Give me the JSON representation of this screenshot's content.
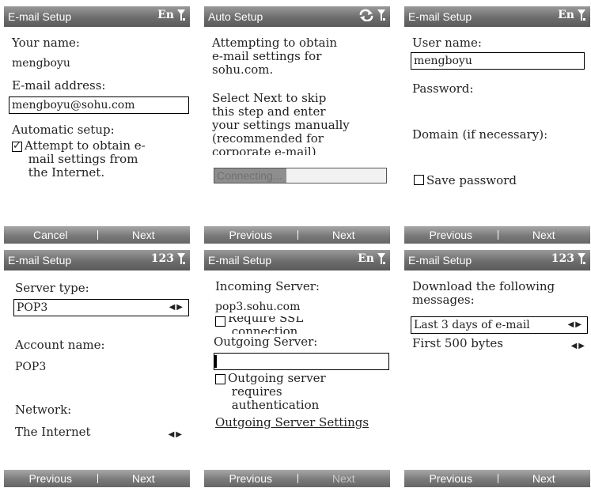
{
  "screens": [
    {
      "title": "E-mail Setup",
      "indicator": "En",
      "name_label": "Your name:",
      "name_value": "mengboyu",
      "email_label": "E-mail address:",
      "email_value": "mengboyu@sohu.com",
      "auto_label": "Automatic setup:",
      "auto_checkbox": "Attempt to obtain e-\n mail settings from\n the Internet.",
      "left_soft": "Cancel",
      "right_soft": "Next"
    },
    {
      "title": "Auto Setup",
      "indicator": "",
      "message1": "Attempting to obtain\ne-mail settings for\nsohu.com.",
      "message2": "Select Next to skip\nthis step and enter\nyour settings manually\n(recommended for\ncorporate e-mail)",
      "progress_text": "Connecting...",
      "progress_fraction": 0.42,
      "left_soft": "Previous",
      "right_soft": "Next"
    },
    {
      "title": "E-mail Setup",
      "indicator": "En",
      "user_label": "User name:",
      "user_value": "mengboyu",
      "password_label": "Password:",
      "domain_label": "Domain (if necessary):",
      "save_password": "Save password",
      "left_soft": "Previous",
      "right_soft": "Next"
    },
    {
      "title": "E-mail Setup",
      "indicator": "123",
      "server_type_label": "Server type:",
      "server_type_value": "POP3",
      "account_label": "Account name:",
      "account_value": "POP3",
      "network_label": "Network:",
      "network_value": "The Internet",
      "left_soft": "Previous",
      "right_soft": "Next"
    },
    {
      "title": "E-mail Setup",
      "indicator": "En",
      "incoming_label": "Incoming Server:",
      "incoming_value": "pop3.sohu.com",
      "ssl_label": "Require SSL\n connection",
      "outgoing_label": "Outgoing Server:",
      "auth_label": "Outgoing server\n requires\n authentication",
      "outgoing_settings_link": "Outgoing Server Settings",
      "left_soft": "Previous",
      "right_soft": "Next"
    },
    {
      "title": "E-mail Setup",
      "indicator": "123",
      "download_label": "Download the following\nmessages:",
      "period_value": "Last 3 days of e-mail",
      "size_value": "First 500 bytes",
      "left_soft": "Previous",
      "right_soft": "Next"
    }
  ],
  "icons": {
    "signal": "signal-antenna-icon",
    "sync": "sync-arrows-icon",
    "arrows": "left-right-arrows-icon"
  },
  "colors": {
    "titlebar": "#6d6d6d",
    "softbar": "#7a7a7a",
    "progress_fill": "#8e8e8e"
  }
}
